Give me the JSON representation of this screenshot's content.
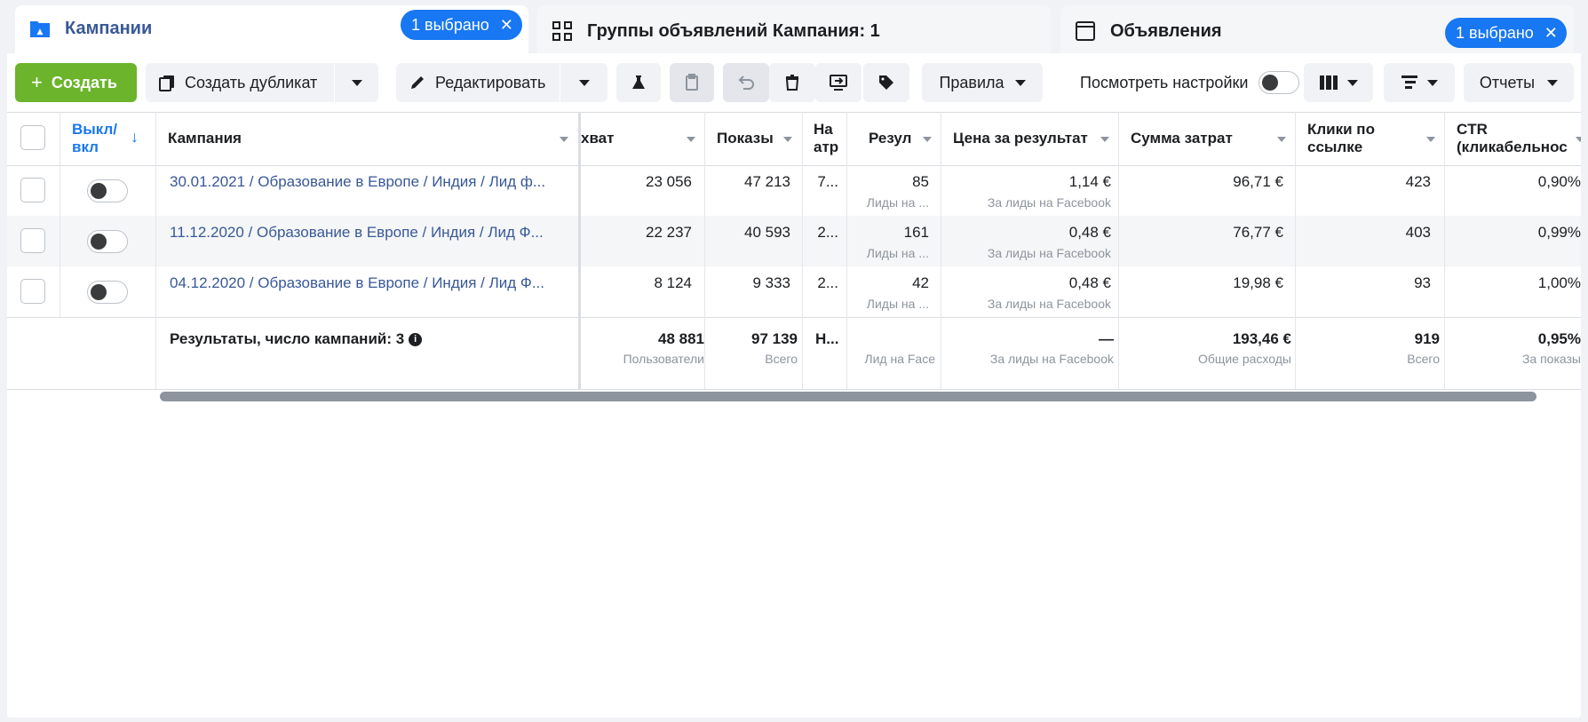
{
  "tabs": {
    "campaigns": {
      "label": "Кампании",
      "chip": "1 выбрано"
    },
    "adsets": {
      "label": "Группы объявлений Кампания: 1"
    },
    "ads": {
      "label": "Объявления",
      "chip": "1 выбрано"
    }
  },
  "toolbar": {
    "create": "Создать",
    "duplicate": "Создать дубликат",
    "edit": "Редактировать",
    "rules": "Правила",
    "view_settings": "Посмотреть настройки",
    "reports": "Отчеты"
  },
  "table": {
    "headers": {
      "toggle": "Выкл/ вкл",
      "campaign": "Кампания",
      "reach": "хват",
      "impressions": "Показы",
      "attribution": "На атр",
      "results": "Резул",
      "cost_per_result": "Цена за результат",
      "amount_spent": "Сумма затрат",
      "link_clicks": "Клики по ссылке",
      "ctr": "CTR (кликабельнос"
    },
    "rows": [
      {
        "name": "30.01.2021 / Образование в Европе / Индия / Лид ф...",
        "reach": "23 056",
        "impressions": "47 213",
        "attribution": "7...",
        "results": "85",
        "results_sub": "Лиды на ...",
        "cpr": "1,14 €",
        "cpr_sub": "За лиды на Facebook",
        "spent": "96,71 €",
        "clicks": "423",
        "ctr": "0,90%"
      },
      {
        "name": "11.12.2020 / Образование в Европе / Индия / Лид Ф...",
        "reach": "22 237",
        "impressions": "40 593",
        "attribution": "2...",
        "results": "161",
        "results_sub": "Лиды на ...",
        "cpr": "0,48 €",
        "cpr_sub": "За лиды на Facebook",
        "spent": "76,77 €",
        "clicks": "403",
        "ctr": "0,99%"
      },
      {
        "name": "04.12.2020 / Образование в Европе / Индия / Лид Ф...",
        "reach": "8 124",
        "impressions": "9 333",
        "attribution": "2...",
        "results": "42",
        "results_sub": "Лиды на ...",
        "cpr": "0,48 €",
        "cpr_sub": "За лиды на Facebook",
        "spent": "19,98 €",
        "clicks": "93",
        "ctr": "1,00%"
      }
    ],
    "totals": {
      "label": "Результаты, число кампаний: 3",
      "reach": "48 881",
      "reach_sub": "Пользователи",
      "impressions": "97 139",
      "impressions_sub": "Всего",
      "attribution": "Н...",
      "results_sub": "Лид на Face",
      "cpr": "—",
      "cpr_sub": "За лиды на Facebook",
      "spent": "193,46 €",
      "spent_sub": "Общие расходы",
      "clicks": "919",
      "clicks_sub": "Всего",
      "ctr": "0,95%",
      "ctr_sub": "За показы"
    }
  },
  "colors": {
    "accent": "#1877f2",
    "create_green": "#6bb42b",
    "link": "#385898"
  }
}
